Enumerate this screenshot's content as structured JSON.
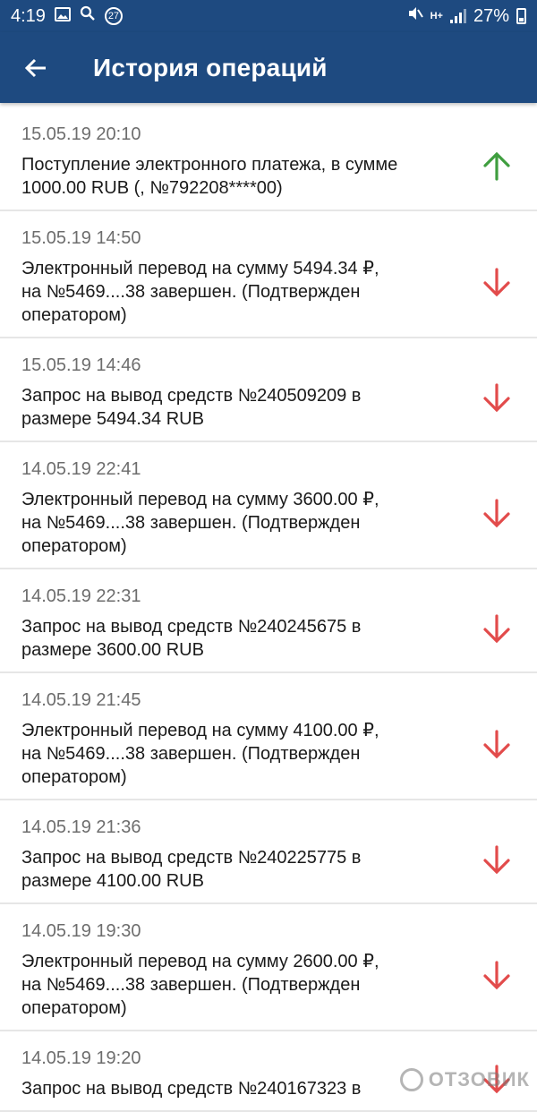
{
  "status_bar": {
    "time": "4:19",
    "notification_count": "27",
    "network": "H+",
    "battery_percent": "27%"
  },
  "app_bar": {
    "title": "История операций",
    "back_icon": "arrow-left-icon"
  },
  "colors": {
    "header": "#1e4a80",
    "incoming_arrow": "#3f9e3f",
    "outgoing_arrow": "#e24b4b"
  },
  "operations": [
    {
      "date": "15.05.19 20:10",
      "description": "Поступление электронного платежа, в сумме\n1000.00 RUB (,  №792208****00)",
      "direction": "in"
    },
    {
      "date": "15.05.19 14:50",
      "description": "Электронный перевод на сумму 5494.34 ₽,\nна №5469....38 завершен. (Подтвержден\nоператором)",
      "direction": "out"
    },
    {
      "date": "15.05.19 14:46",
      "description": "Запрос на вывод средств №240509209 в\nразмере 5494.34 RUB",
      "direction": "out"
    },
    {
      "date": "14.05.19 22:41",
      "description": "Электронный перевод на сумму 3600.00 ₽,\nна №5469....38 завершен. (Подтвержден\nоператором)",
      "direction": "out"
    },
    {
      "date": "14.05.19 22:31",
      "description": "Запрос на вывод средств №240245675 в\nразмере 3600.00 RUB",
      "direction": "out"
    },
    {
      "date": "14.05.19 21:45",
      "description": "Электронный перевод на сумму 4100.00 ₽,\nна №5469....38 завершен. (Подтвержден\nоператором)",
      "direction": "out"
    },
    {
      "date": "14.05.19 21:36",
      "description": "Запрос на вывод средств №240225775 в\nразмере 4100.00 RUB",
      "direction": "out"
    },
    {
      "date": "14.05.19 19:30",
      "description": "Электронный перевод на сумму 2600.00 ₽,\nна №5469....38 завершен. (Подтвержден\nоператором)",
      "direction": "out"
    },
    {
      "date": "14.05.19 19:20",
      "description": "Запрос на вывод средств №240167323 в",
      "direction": "out"
    }
  ],
  "watermark": "ОТЗОВИК"
}
